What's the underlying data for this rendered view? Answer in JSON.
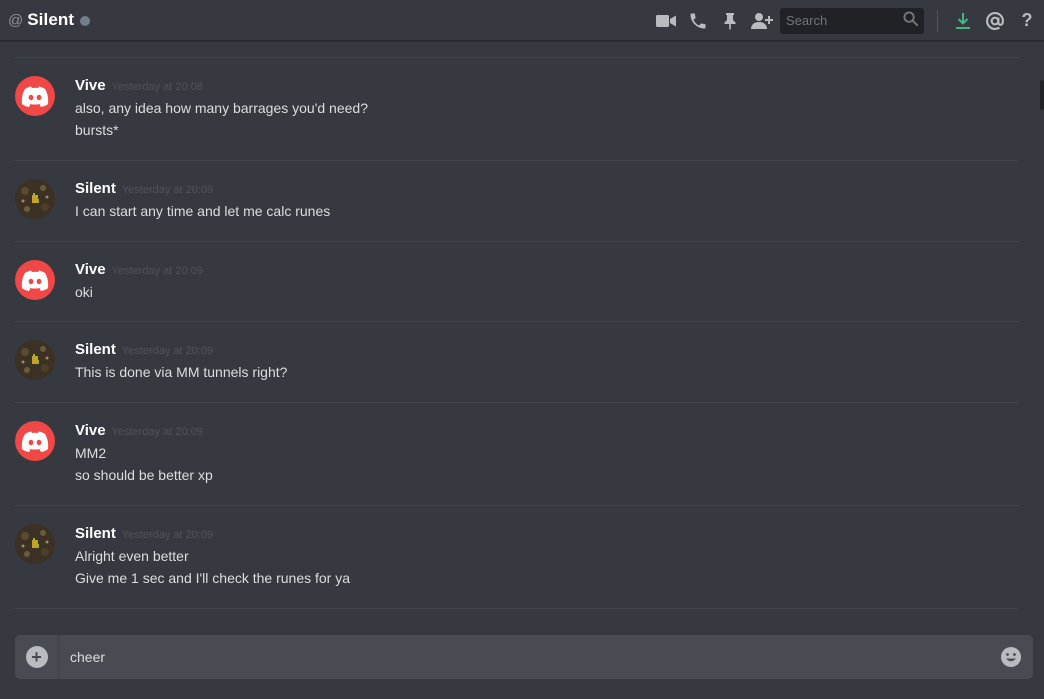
{
  "channel": {
    "prefix": "@",
    "name": "Silent",
    "status": "offline"
  },
  "toolbar": {
    "icons": [
      "video-call-icon",
      "voice-call-icon",
      "pin-icon",
      "add-friend-icon"
    ],
    "search_placeholder": "Search",
    "right_icons": [
      "download-icon",
      "mentions-icon",
      "help-icon"
    ],
    "help_label": "?"
  },
  "messages": [
    {
      "author": "Vive",
      "avatar": "discord-logo",
      "timestamp": "Yesterday at 20:08",
      "lines": [
        "also, any idea how many barrages you'd need?",
        "bursts*"
      ]
    },
    {
      "author": "Silent",
      "avatar": "game-avatar",
      "timestamp": "Yesterday at 20:09",
      "lines": [
        "I can start any time and let me calc runes"
      ]
    },
    {
      "author": "Vive",
      "avatar": "discord-logo",
      "timestamp": "Yesterday at 20:09",
      "lines": [
        "oki"
      ]
    },
    {
      "author": "Silent",
      "avatar": "game-avatar",
      "timestamp": "Yesterday at 20:09",
      "lines": [
        "This is done via MM tunnels right?"
      ]
    },
    {
      "author": "Vive",
      "avatar": "discord-logo",
      "timestamp": "Yesterday at 20:09",
      "lines": [
        "MM2",
        "so should be better xp"
      ]
    },
    {
      "author": "Silent",
      "avatar": "game-avatar",
      "timestamp": "Yesterday at 20:09",
      "lines": [
        "Alright even better",
        "Give me 1 sec and I'll check the runes for ya"
      ]
    }
  ],
  "composer": {
    "value": "cheer"
  },
  "colors": {
    "background": "#36393f",
    "header_text": "#ffffff",
    "discord_red": "#f04747",
    "download_green": "#43b581",
    "composer_bg": "#484c52"
  }
}
